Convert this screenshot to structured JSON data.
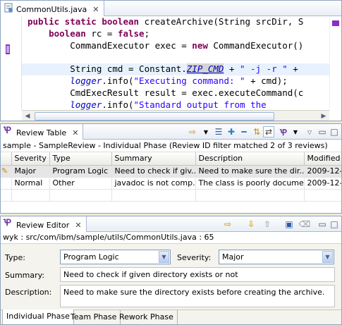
{
  "editor": {
    "tab_title": "CommonUtils.java",
    "close_glyph": "✕",
    "lines": [
      {
        "parts": [
          {
            "t": "public static boolean",
            "c": "kw"
          },
          {
            "t": " createArchive(String srcDir, S",
            "c": ""
          }
        ]
      },
      {
        "parts": [
          {
            "t": "    boolean",
            "c": "kw"
          },
          {
            "t": " rc = ",
            "c": ""
          },
          {
            "t": "false",
            "c": "kw"
          },
          {
            "t": ";",
            "c": ""
          }
        ]
      },
      {
        "parts": [
          {
            "t": "        CommandExecutor exec = ",
            "c": ""
          },
          {
            "t": "new",
            "c": "kw"
          },
          {
            "t": " CommandExecutor()",
            "c": ""
          }
        ]
      },
      {
        "parts": [
          {
            "t": "",
            "c": ""
          }
        ]
      },
      {
        "parts": [
          {
            "t": "        String cmd = Constant.",
            "c": ""
          },
          {
            "t": "ZIP_CMD",
            "c": "occ"
          },
          {
            "t": " + ",
            "c": ""
          },
          {
            "t": "\" -j -r \"",
            "c": "str"
          },
          {
            "t": " +",
            "c": ""
          }
        ]
      },
      {
        "parts": [
          {
            "t": "        ",
            "c": ""
          },
          {
            "t": "logger",
            "c": "fld"
          },
          {
            "t": ".info(",
            "c": ""
          },
          {
            "t": "\"Executing command: \"",
            "c": "str"
          },
          {
            "t": " + cmd);",
            "c": ""
          }
        ]
      },
      {
        "parts": [
          {
            "t": "        CmdExecResult result = exec.executeCommand(c",
            "c": ""
          }
        ]
      },
      {
        "parts": [
          {
            "t": "        ",
            "c": ""
          },
          {
            "t": "logger",
            "c": "fld"
          },
          {
            "t": ".info(",
            "c": ""
          },
          {
            "t": "\"Standard output from the",
            "c": "str"
          }
        ]
      }
    ]
  },
  "review_table": {
    "tab_title": "Review Table",
    "close_glyph": "✕",
    "subtitle": "sample - SampleReview - Individual Phase (Review ID filter matched 2 of 3 reviews)",
    "columns": [
      "",
      "Severity",
      "Type",
      "Summary",
      "Description",
      "Modified"
    ],
    "rows": [
      {
        "severity": "Major",
        "type": "Program Logic",
        "summary": "Need to check if giv...",
        "description": "Need to make sure the dir...",
        "modified": "2009-12-0"
      },
      {
        "severity": "Normal",
        "type": "Other",
        "summary": "javadoc is not comp...",
        "description": "The class is poorly docume...",
        "modified": "2009-12-0"
      }
    ]
  },
  "review_editor": {
    "tab_title": "Review Editor",
    "close_glyph": "✕",
    "path": "wyk : src/com/ibm/sample/utils/CommonUtils.java : 65",
    "type_label": "Type:",
    "type_value": "Program Logic",
    "severity_label": "Severity:",
    "severity_value": "Major",
    "summary_label": "Summary:",
    "summary_value": "Need to check if given directory exists or not",
    "description_label": "Description:",
    "description_value": "Need to make sure the directory exists before creating the archive.",
    "phase_tabs": [
      "Individual Phase",
      "Team Phase",
      "Rework Phase"
    ]
  },
  "colors": {
    "accent": "#7f0055",
    "string": "#2a00ff",
    "field": "#0000c0",
    "review_icon": "#6a2fa0"
  }
}
